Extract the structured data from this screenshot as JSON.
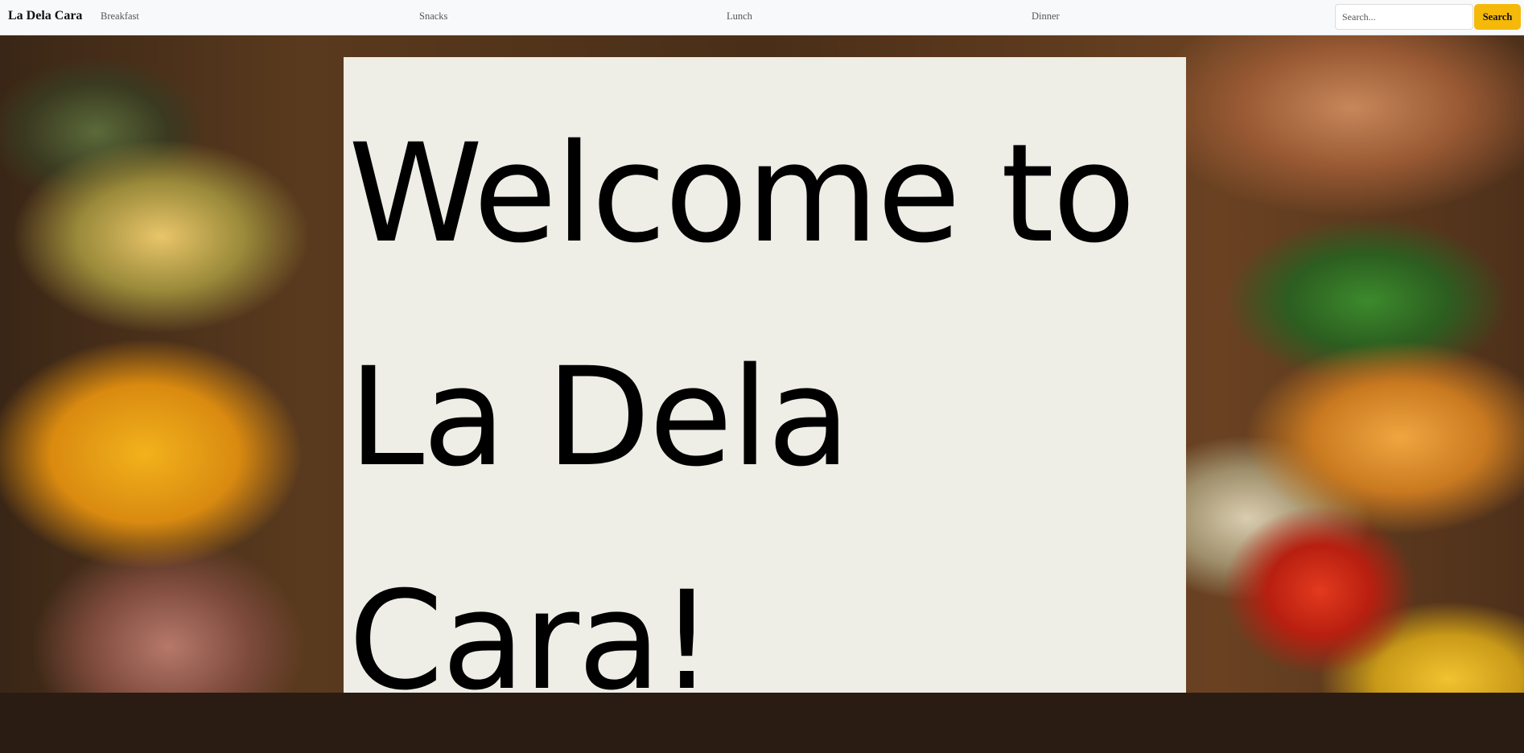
{
  "navbar": {
    "brand": "La Dela Cara",
    "links": [
      {
        "label": "Breakfast"
      },
      {
        "label": "Snacks"
      },
      {
        "label": "Lunch"
      },
      {
        "label": "Dinner"
      }
    ],
    "search": {
      "placeholder": "Search...",
      "value": "",
      "button_label": "Search",
      "button_color": "#f5b90a"
    }
  },
  "hero": {
    "heading": "Welcome to La Dela Cara!",
    "panel_color": "#eeede6",
    "background": "food-photo"
  }
}
